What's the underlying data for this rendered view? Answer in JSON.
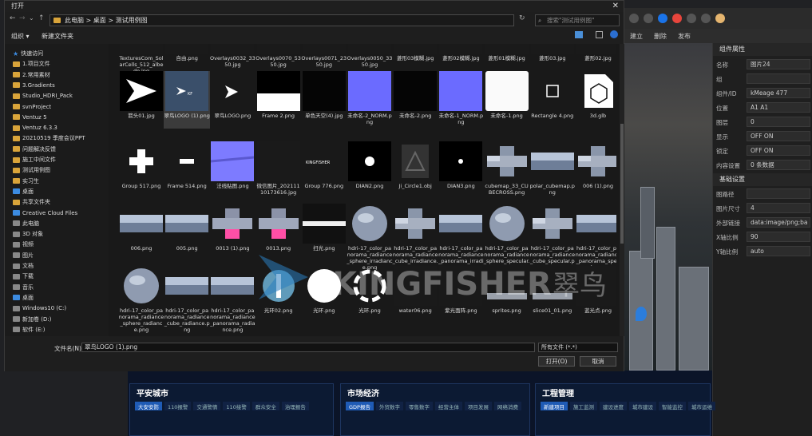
{
  "dialog": {
    "title": "打开",
    "address": [
      "此电脑",
      "桌面",
      "测试用例图"
    ],
    "search_placeholder": "搜索\"测试用例图\"",
    "organize": "组织 ▾",
    "new_folder": "新建文件夹",
    "filename_label": "文件名(N):",
    "filename_value": "翠鸟LOGO (1).png",
    "filetype_value": "所有文件 (*.*)",
    "open_button": "打开(O)",
    "cancel_button": "取消"
  },
  "nav": [
    {
      "label": "快速访问",
      "type": "star"
    },
    {
      "label": "1.项目文件",
      "type": "folder"
    },
    {
      "label": "2.常用素材",
      "type": "folder"
    },
    {
      "label": "3.Gradients",
      "type": "folder"
    },
    {
      "label": "Studio_HDRI_Pack",
      "type": "folder"
    },
    {
      "label": "svnProject",
      "type": "folder"
    },
    {
      "label": "Ventuz 5",
      "type": "folder"
    },
    {
      "label": "Ventuz 6.3.3",
      "type": "folder"
    },
    {
      "label": "20210519 季度会议PPT",
      "type": "folder"
    },
    {
      "label": "问题解决反馈",
      "type": "folder"
    },
    {
      "label": "施工中间文件",
      "type": "folder"
    },
    {
      "label": "测试用例图",
      "type": "folder"
    },
    {
      "label": "实习生",
      "type": "folder"
    },
    {
      "label": "桌面",
      "type": "blue"
    },
    {
      "label": "共享文件夹",
      "type": "folder"
    },
    {
      "label": "Creative Cloud Files",
      "type": "blue"
    },
    {
      "label": "此电脑",
      "type": "gray"
    },
    {
      "label": "3D 对象",
      "type": "gray"
    },
    {
      "label": "视频",
      "type": "gray"
    },
    {
      "label": "图片",
      "type": "gray"
    },
    {
      "label": "文档",
      "type": "gray"
    },
    {
      "label": "下载",
      "type": "gray"
    },
    {
      "label": "音乐",
      "type": "gray"
    },
    {
      "label": "桌面",
      "type": "blue"
    },
    {
      "label": "Windows10 (C:)",
      "type": "gray"
    },
    {
      "label": "新加卷 (D:)",
      "type": "gray"
    },
    {
      "label": "软件 (E:)",
      "type": "gray"
    }
  ],
  "files": [
    {
      "name": "TexturesCom_SolarCells_512_albedo.jpg",
      "style": "dark"
    },
    {
      "name": "自由.png",
      "style": "dark"
    },
    {
      "name": "Overlays0032_3350.jpg",
      "style": "dark"
    },
    {
      "name": "Overlays0070_5350.jpg",
      "style": "dark"
    },
    {
      "name": "Overlays0071_2350.jpg",
      "style": "dark"
    },
    {
      "name": "Overlays0050_3350.jpg",
      "style": "dark"
    },
    {
      "name": "菱形03模糊.jpg",
      "style": "dark"
    },
    {
      "name": "菱形02模糊.jpg",
      "style": "dark"
    },
    {
      "name": "菱形01模糊.jpg",
      "style": "dark"
    },
    {
      "name": "菱形03.jpg",
      "style": "dark"
    },
    {
      "name": "菱形02.jpg",
      "style": "dark"
    },
    {
      "name": "箭头01.jpg",
      "style": "arrow"
    },
    {
      "name": "翠鸟LOGO (1).png",
      "style": "logo-sel"
    },
    {
      "name": "翠鸟LOGO.png",
      "style": "logo"
    },
    {
      "name": "Frame 2.png",
      "style": "frame2"
    },
    {
      "name": "单色天空(4).jpg",
      "style": "black"
    },
    {
      "name": "未命名-2_NORM.png",
      "style": "purple"
    },
    {
      "name": "未命名-2.png",
      "style": "black"
    },
    {
      "name": "未命名-1_NORM.png",
      "style": "purple"
    },
    {
      "name": "未命名-1.png",
      "style": "white"
    },
    {
      "name": "Rectangle 4.png",
      "style": "rect"
    },
    {
      "name": "3d.glb",
      "style": "glb"
    },
    {
      "name": "Group 517.png",
      "style": "plus"
    },
    {
      "name": "Frame 514.png",
      "style": "minus"
    },
    {
      "name": "法线贴图.png",
      "style": "normal"
    },
    {
      "name": "微信图片_20211110173616.jpg",
      "style": "dark"
    },
    {
      "name": "Group 776.png",
      "style": "kf-small"
    },
    {
      "name": "DIAN2.png",
      "style": "dot"
    },
    {
      "name": "Ji_Circle1.obj",
      "style": "obj"
    },
    {
      "name": "DIAN3.png",
      "style": "dotsmall"
    },
    {
      "name": "cubemap_33_CUBECROSS.png",
      "style": "cube"
    },
    {
      "name": "polar_cubemap.png",
      "style": "pano"
    },
    {
      "name": "006 (1).png",
      "style": "cube"
    },
    {
      "name": "006.png",
      "style": "pano"
    },
    {
      "name": "005.png",
      "style": "pano"
    },
    {
      "name": "0013 (1).png",
      "style": "pink"
    },
    {
      "name": "0013.png",
      "style": "pink"
    },
    {
      "name": "扫光.png",
      "style": "sweep"
    },
    {
      "name": "hdri-17_color_panorama_radiance_sphere_irradiance.png",
      "style": "sphere"
    },
    {
      "name": "hdri-17_color_panorama_radiance_cube_irradiance.png",
      "style": "cube"
    },
    {
      "name": "hdri-17_color_panorama_radiance_panorama_irradiance.png",
      "style": "pano"
    },
    {
      "name": "hdri-17_color_panorama_radiance_sphere_specular.png",
      "style": "sphere"
    },
    {
      "name": "hdri-17_color_panorama_radiance_cube_specular.png",
      "style": "cube"
    },
    {
      "name": "hdri-17_color_panorama_radiance_panorama_specular.png",
      "style": "pano"
    },
    {
      "name": "hdri-17_color_panorama_radiance_sphere_radiance.png",
      "style": "sphere"
    },
    {
      "name": "hdri-17_color_panorama_radiance_cube_radiance.png",
      "style": "pano"
    },
    {
      "name": "hdri-17_color_panorama_radiance_panorama_radiance.png",
      "style": "pano"
    },
    {
      "name": "光环02.png",
      "style": "ring"
    },
    {
      "name": "光环.png",
      "style": "whitecircle"
    },
    {
      "name": "光环.png",
      "style": "dashring"
    },
    {
      "name": "water06.png",
      "style": "dark"
    },
    {
      "name": "紫光面阵.png",
      "style": "dark"
    },
    {
      "name": "sprites.png",
      "style": "sprites"
    },
    {
      "name": "slice01_01.png",
      "style": "sprites"
    },
    {
      "name": "蓝光点.png",
      "style": "dark"
    }
  ],
  "watermark": {
    "brand": "KINGFISHER",
    "cn": "翠鸟"
  },
  "editor": {
    "toolbar": [
      "建立",
      "删除",
      "发布"
    ],
    "props": [
      {
        "label": "名称",
        "value": "图片24"
      },
      {
        "label": "组",
        "value": ""
      },
      {
        "label": "组件/ID",
        "value": "kMeage 477"
      },
      {
        "label": "位置",
        "value": "A1 A1"
      },
      {
        "label": "图层",
        "value": "0"
      },
      {
        "label": "显示",
        "value": "OFF    ON"
      },
      {
        "label": "锁定",
        "value": "OFF    ON"
      },
      {
        "label": "内容设置",
        "value": "0 条数据"
      }
    ],
    "section": "基础设置",
    "props2": [
      {
        "label": "图路径",
        "value": ""
      },
      {
        "label": "图片尺寸",
        "value": "4"
      },
      {
        "label": "外部链接",
        "value": "data:image/png;ba"
      },
      {
        "label": "X轴比例",
        "value": "90"
      },
      {
        "label": "Y轴比例",
        "value": "auto"
      }
    ],
    "section_top": "组件属性"
  },
  "dashboard": {
    "panels": [
      {
        "title": "平安城市",
        "tabs": [
          "大安安防",
          "110报警",
          "交通警情",
          "110接警",
          "群众安全",
          "治理报告"
        ]
      },
      {
        "title": "市场经济",
        "tabs": [
          "GDP报告",
          "外贸数字",
          "零售数字",
          "经营主体",
          "项目发展",
          "网络消费"
        ]
      },
      {
        "title": "工程管理",
        "tabs": [
          "新建项目",
          "施工监测",
          "建设进度",
          "城市建设",
          "智能监控",
          "城市运维"
        ]
      }
    ]
  }
}
